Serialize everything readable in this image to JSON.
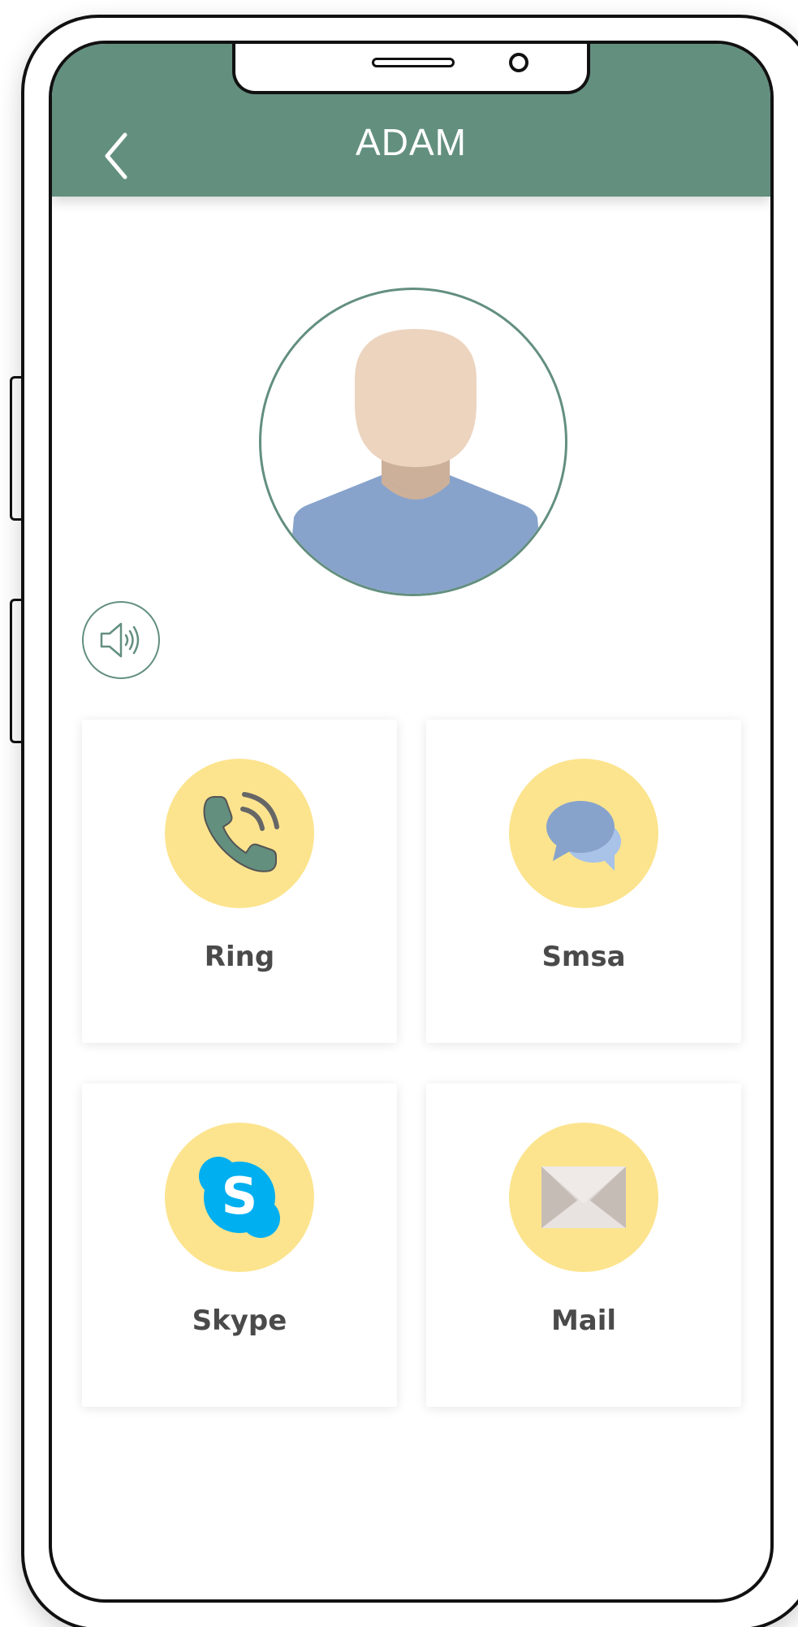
{
  "header": {
    "title": "ADAM",
    "background_color": "#638f7f",
    "back_icon": "chevron-left-icon"
  },
  "profile": {
    "avatar_icon": "person-avatar-icon",
    "volume_icon": "speaker-volume-icon"
  },
  "actions": [
    {
      "label": "Ring",
      "icon": "phone-call-icon"
    },
    {
      "label": "Smsa",
      "icon": "chat-bubbles-icon"
    },
    {
      "label": "Skype",
      "icon": "skype-icon"
    },
    {
      "label": "Mail",
      "icon": "envelope-icon"
    }
  ],
  "colors": {
    "accent": "#638f7f",
    "icon_circle": "#fce48e",
    "label_text": "#4a4a4a"
  }
}
